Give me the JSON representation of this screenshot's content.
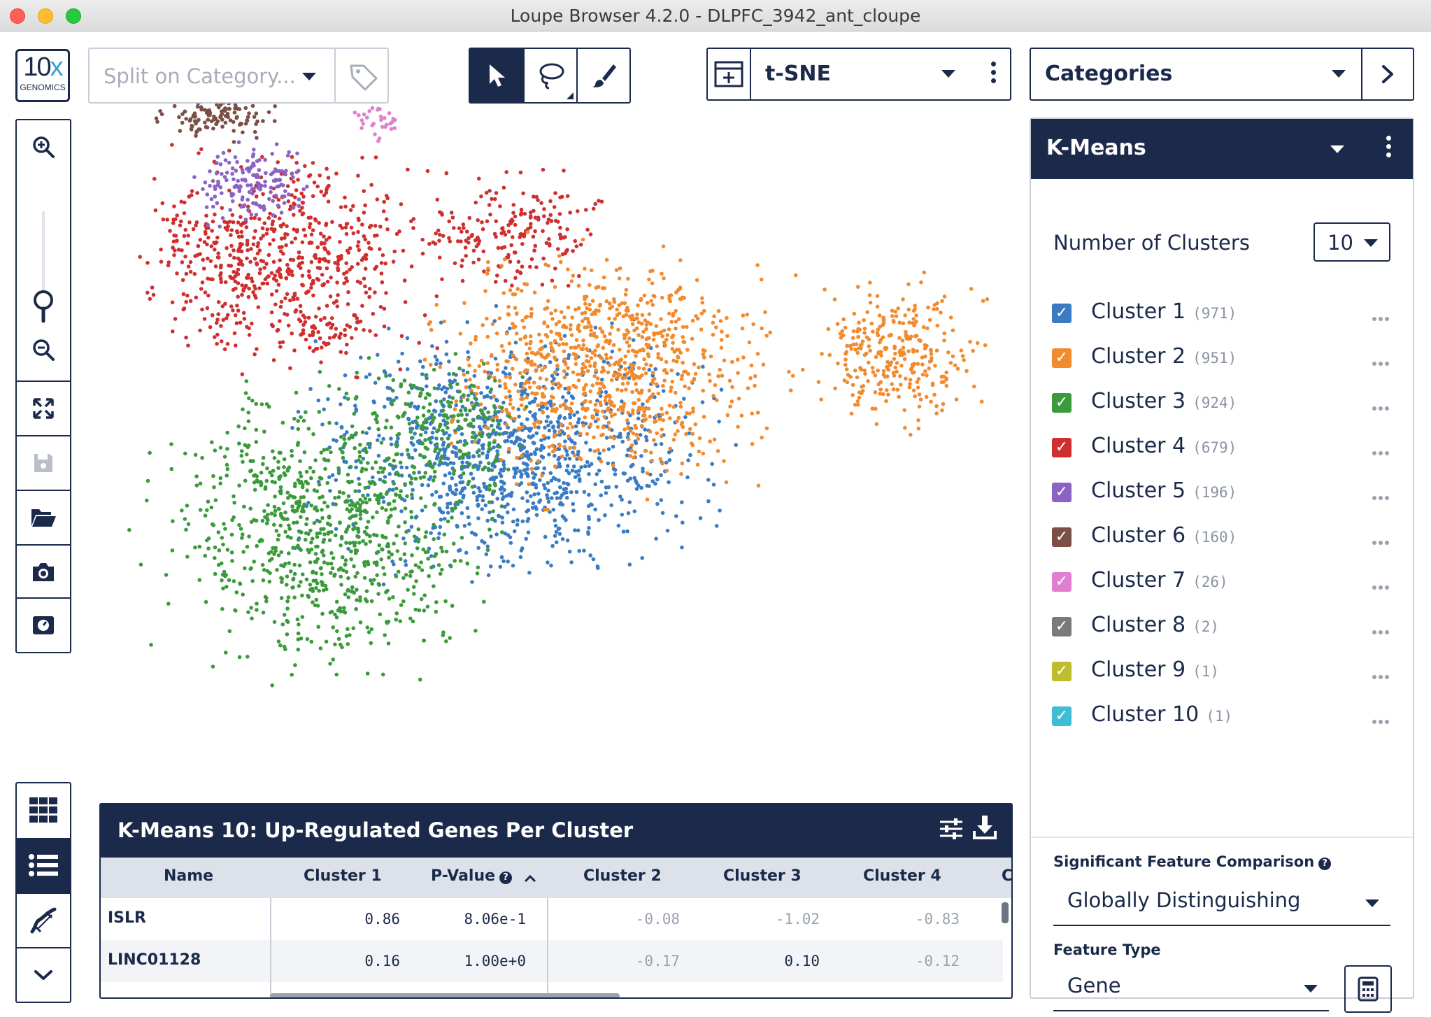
{
  "window": {
    "title": "Loupe Browser 4.2.0 - DLPFC_3942_ant_cloupe"
  },
  "logo": {
    "big_a": "10",
    "big_b": "x",
    "small": "GENOMICS"
  },
  "split": {
    "placeholder": "Split on Category..."
  },
  "projection": {
    "selected": "t-SNE"
  },
  "categories_selector": {
    "selected": "Categories"
  },
  "panel": {
    "title": "K-Means",
    "num_clusters_label": "Number of Clusters",
    "num_clusters_value": "10",
    "clusters": [
      {
        "name": "Cluster 1",
        "count": "(971)",
        "color": "#3a7cc3"
      },
      {
        "name": "Cluster 2",
        "count": "(951)",
        "color": "#f28a2e"
      },
      {
        "name": "Cluster 3",
        "count": "(924)",
        "color": "#3b9a3b"
      },
      {
        "name": "Cluster 4",
        "count": "(679)",
        "color": "#cf2f2f"
      },
      {
        "name": "Cluster 5",
        "count": "(196)",
        "color": "#8a63c4"
      },
      {
        "name": "Cluster 6",
        "count": "(160)",
        "color": "#7b4f45"
      },
      {
        "name": "Cluster 7",
        "count": "(26)",
        "color": "#e07fd0"
      },
      {
        "name": "Cluster 8",
        "count": "(2)",
        "color": "#7a7a7a"
      },
      {
        "name": "Cluster 9",
        "count": "(1)",
        "color": "#bdbd2e"
      },
      {
        "name": "Cluster 10",
        "count": "(1)",
        "color": "#3fbdd6"
      }
    ],
    "sig_label": "Significant Feature Comparison",
    "sig_value": "Globally Distinguishing",
    "feature_type_label": "Feature Type",
    "feature_type_value": "Gene"
  },
  "table": {
    "title": "K-Means 10: Up-Regulated Genes Per Cluster",
    "columns": [
      "Name",
      "Cluster 1",
      "P-Value",
      "Cluster 2",
      "Cluster 3",
      "Cluster 4",
      "C"
    ],
    "rows": [
      {
        "name": "ISLR",
        "c1": "0.86",
        "p": "8.06e-1",
        "c2": "-0.08",
        "c3": "-1.02",
        "c4": "-0.83"
      },
      {
        "name": "LINC01128",
        "c1": "0.16",
        "p": "1.00e+0",
        "c2": "-0.17",
        "c3": "0.10",
        "c4": "-0.12"
      }
    ]
  }
}
